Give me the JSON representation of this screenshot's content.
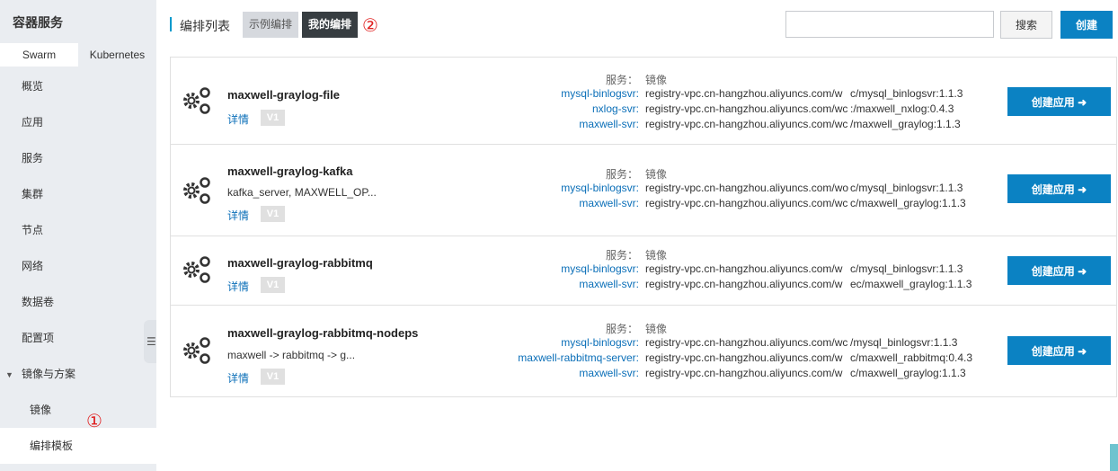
{
  "sidebar": {
    "title": "容器服务",
    "tabs": [
      "Swarm",
      "Kubernetes"
    ],
    "items": [
      "概览",
      "应用",
      "服务",
      "集群",
      "节点",
      "网络",
      "数据卷",
      "配置项"
    ],
    "group": "镜像与方案",
    "sub_items": [
      "镜像",
      "编排模板"
    ],
    "marker_1": "①"
  },
  "header": {
    "title": "编排列表",
    "tab_example": "示例编排",
    "tab_mine": "我的编排",
    "marker_2": "②",
    "search_placeholder": "",
    "search_label": "搜索",
    "create_label": "创建"
  },
  "card_labels": {
    "services_label": "服务：",
    "image_label": "镜像",
    "detail": "详情",
    "version": "V1",
    "deploy": "创建应用 ➜"
  },
  "templates": [
    {
      "name": "maxwell-graylog-file",
      "desc": "",
      "services": [
        {
          "name": "mysql-binlogsvr:",
          "image_a": "registry-vpc.cn-hangzhou.aliyuncs.com/w",
          "image_b": "c/mysql_binlogsvr:1.1.3"
        },
        {
          "name": "nxlog-svr:",
          "image_a": "registry-vpc.cn-hangzhou.aliyuncs.com/wc",
          "image_b": ":/maxwell_nxlog:0.4.3"
        },
        {
          "name": "maxwell-svr:",
          "image_a": "registry-vpc.cn-hangzhou.aliyuncs.com/wc",
          "image_b": "/maxwell_graylog:1.1.3"
        }
      ]
    },
    {
      "name": "maxwell-graylog-kafka",
      "desc": "kafka_server, MAXWELL_OP...",
      "services": [
        {
          "name": "mysql-binlogsvr:",
          "image_a": "registry-vpc.cn-hangzhou.aliyuncs.com/wo",
          "image_b": "c/mysql_binlogsvr:1.1.3"
        },
        {
          "name": "maxwell-svr:",
          "image_a": "registry-vpc.cn-hangzhou.aliyuncs.com/wc",
          "image_b": "c/maxwell_graylog:1.1.3"
        }
      ]
    },
    {
      "name": "maxwell-graylog-rabbitmq",
      "desc": "",
      "services": [
        {
          "name": "mysql-binlogsvr:",
          "image_a": "registry-vpc.cn-hangzhou.aliyuncs.com/w",
          "image_b": "c/mysql_binlogsvr:1.1.3"
        },
        {
          "name": "maxwell-svr:",
          "image_a": "registry-vpc.cn-hangzhou.aliyuncs.com/w",
          "image_b": "ec/maxwell_graylog:1.1.3"
        }
      ]
    },
    {
      "name": "maxwell-graylog-rabbitmq-nodeps",
      "desc": "maxwell -> rabbitmq -> g...",
      "services": [
        {
          "name": "mysql-binlogsvr:",
          "image_a": "registry-vpc.cn-hangzhou.aliyuncs.com/wc",
          "image_b": "/mysql_binlogsvr:1.1.3"
        },
        {
          "name": "maxwell-rabbitmq-server:",
          "image_a": "registry-vpc.cn-hangzhou.aliyuncs.com/w",
          "image_b": "c/maxwell_rabbitmq:0.4.3"
        },
        {
          "name": "maxwell-svr:",
          "image_a": "registry-vpc.cn-hangzhou.aliyuncs.com/w",
          "image_b": "c/maxwell_graylog:1.1.3"
        }
      ]
    }
  ]
}
